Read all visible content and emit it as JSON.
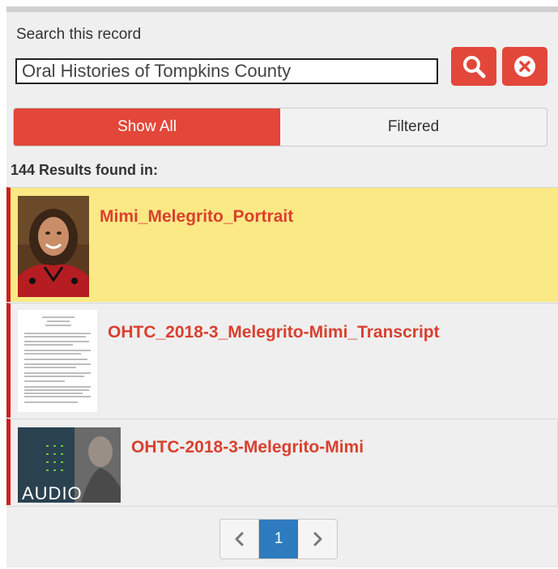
{
  "search": {
    "label": "Search this record",
    "value": "Oral Histories of Tompkins County",
    "search_icon": "search-icon",
    "clear_icon": "close-circle-icon"
  },
  "toggle": {
    "show_all": "Show All",
    "filtered": "Filtered",
    "active": "show_all"
  },
  "results": {
    "count_text": "144 Results found in:",
    "items": [
      {
        "title": "Mimi_Melegrito_Portrait",
        "thumb": "portrait-photo",
        "highlighted": true
      },
      {
        "title": "OHTC_2018-3_Melegrito-Mimi_Transcript",
        "thumb": "document-page",
        "highlighted": false
      },
      {
        "title": "OHTC-2018-3-Melegrito-Mimi",
        "thumb": "audio-thumbnail",
        "thumb_text": "AUDIO",
        "highlighted": false
      }
    ]
  },
  "pagination": {
    "prev_icon": "chevron-left-icon",
    "current_page": "1",
    "next_icon": "chevron-right-icon"
  },
  "colors": {
    "accent": "#e2473a",
    "highlight": "#fbe985",
    "result_title": "#d9402f",
    "page_active": "#2e7bbf",
    "left_bar": "#cf1f1f"
  }
}
